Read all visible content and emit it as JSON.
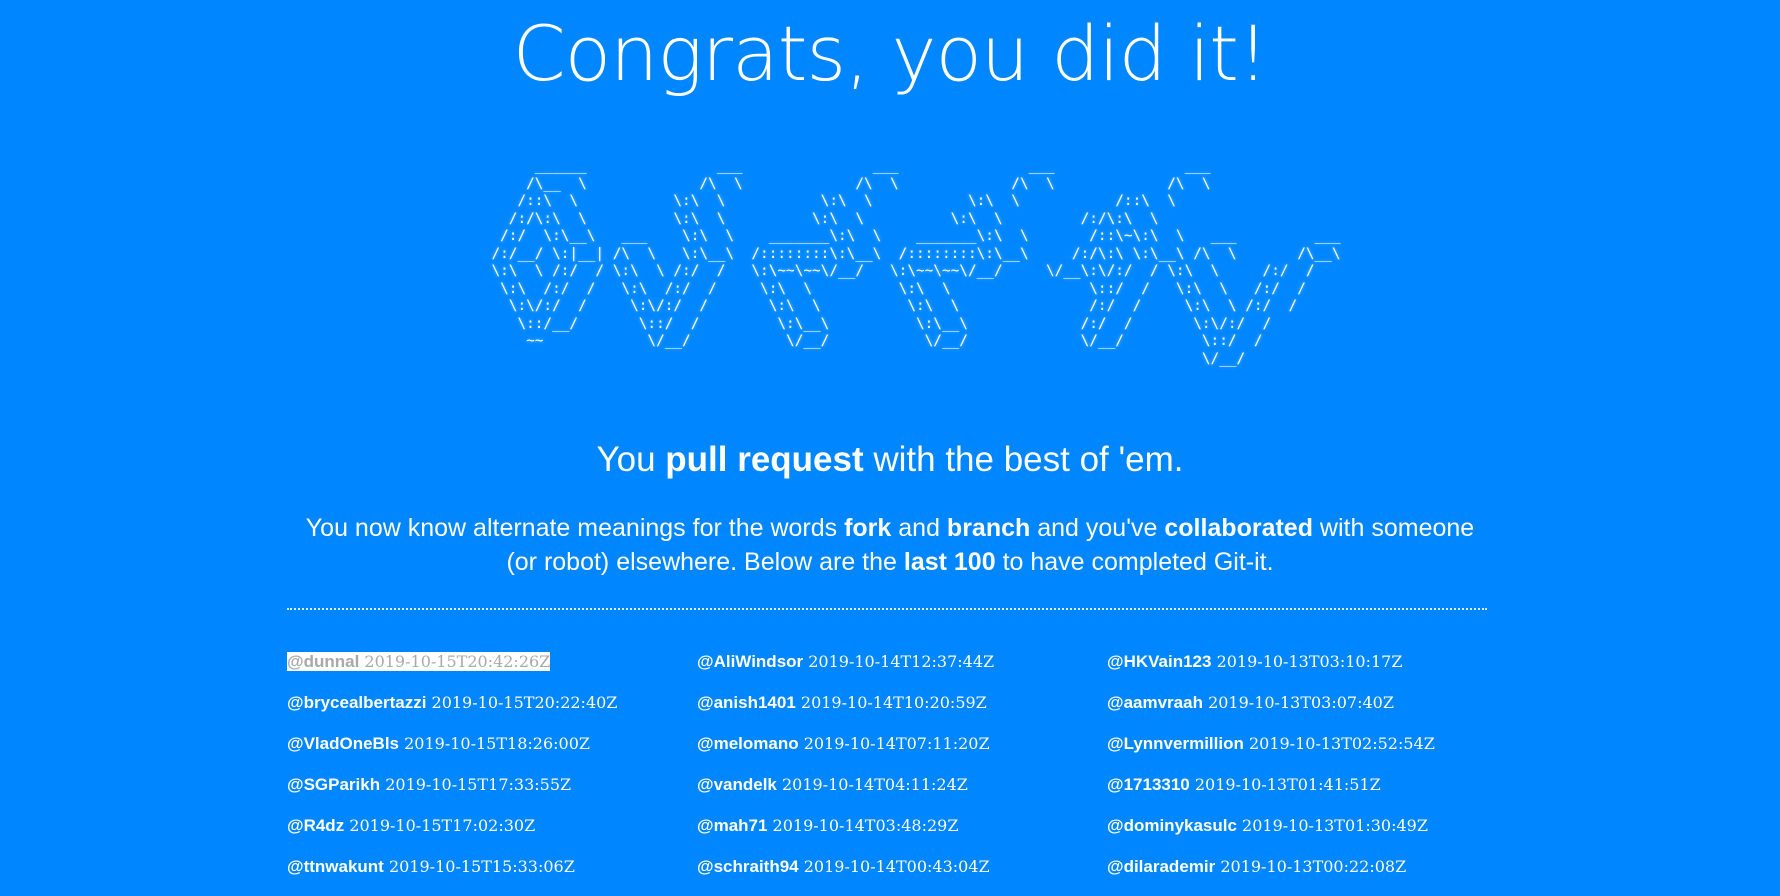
{
  "title": "Congrats, you did it!",
  "ascii_art": "           ______               ___               ___               ___               ___\n          /\\__  \\             /\\  \\             /\\  \\             /\\  \\             /\\  \\\n         /::\\  \\           \\:\\  \\           \\:\\  \\           \\:\\  \\           /::\\  \\\n        /:/\\:\\  \\          \\:\\  \\          \\:\\  \\          \\:\\  \\         /:/\\:\\  \\\n       /:/  \\:\\__\\   ___    \\:\\  \\    _______\\:\\  \\    _______\\:\\  \\       /::\\~\\:\\  \\   ___         ___\n      /:/__/ \\:|__| /\\  \\   \\:\\__\\  /::::::::\\:\\__\\  /::::::::\\:\\__\\     /:/\\:\\ \\:\\__\\ /\\  \\       /\\__\\\n      \\:\\  \\ /:/  / \\:\\  \\ /:/  /   \\:\\~~\\~~\\/__/   \\:\\~~\\~~\\/__/     \\/__\\:\\/:/  / \\:\\  \\     /:/  /\n       \\:\\  /:/  /   \\:\\  /:/  /     \\:\\  \\          \\:\\  \\                \\::/  /   \\:\\  \\   /:/  /\n        \\:\\/:/  /     \\:\\/:/  /       \\:\\  \\          \\:\\  \\               /:/  /     \\:\\  \\ /:/  /\n         \\::/__/       \\::/  /         \\:\\__\\          \\:\\__\\             /:/  /       \\:\\/:/  /\n          ~~            \\/__/           \\/__/           \\/__/             \\/__/         \\::/  /\n                                                                                        \\/__/",
  "tagline": {
    "before": "You ",
    "bold": "pull request",
    "after": " with the best of 'em."
  },
  "intro": {
    "t1": "You now know alternate meanings for the words ",
    "b1": "fork",
    "t2": " and ",
    "b2": "branch",
    "t3": " and you've ",
    "b3": "collaborated",
    "t4": " with someone (or robot) elsewhere. Below are the ",
    "b4": "last 100",
    "t5": " to have completed Git-it."
  },
  "completions": {
    "col1": [
      {
        "user": "@dunnal",
        "time": "2019-10-15T20:42:26Z"
      },
      {
        "user": "@brycealbertazzi",
        "time": "2019-10-15T20:22:40Z"
      },
      {
        "user": "@VladOneBls",
        "time": "2019-10-15T18:26:00Z"
      },
      {
        "user": "@SGParikh",
        "time": "2019-10-15T17:33:55Z"
      },
      {
        "user": "@R4dz",
        "time": "2019-10-15T17:02:30Z"
      },
      {
        "user": "@ttnwakunt",
        "time": "2019-10-15T15:33:06Z"
      }
    ],
    "col2": [
      {
        "user": "@AliWindsor",
        "time": "2019-10-14T12:37:44Z"
      },
      {
        "user": "@anish1401",
        "time": "2019-10-14T10:20:59Z"
      },
      {
        "user": "@melomano",
        "time": "2019-10-14T07:11:20Z"
      },
      {
        "user": "@vandelk",
        "time": "2019-10-14T04:11:24Z"
      },
      {
        "user": "@mah71",
        "time": "2019-10-14T03:48:29Z"
      },
      {
        "user": "@schraith94",
        "time": "2019-10-14T00:43:04Z"
      }
    ],
    "col3": [
      {
        "user": "@HKVain123",
        "time": "2019-10-13T03:10:17Z"
      },
      {
        "user": "@aamvraah",
        "time": "2019-10-13T03:07:40Z"
      },
      {
        "user": "@Lynnvermillion",
        "time": "2019-10-13T02:52:54Z"
      },
      {
        "user": "@1713310",
        "time": "2019-10-13T01:41:51Z"
      },
      {
        "user": "@dominykasulc",
        "time": "2019-10-13T01:30:49Z"
      },
      {
        "user": "@dilarademir",
        "time": "2019-10-13T00:22:08Z"
      }
    ]
  },
  "colors": {
    "background": "#0087ff",
    "text": "#ffffff",
    "highlight_bg": "#ffffff",
    "highlight_text": "#a9a9a9"
  }
}
